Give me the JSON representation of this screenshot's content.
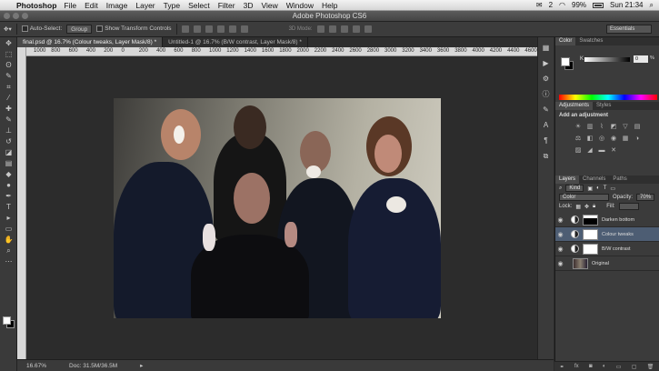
{
  "menubar": {
    "app": "Photoshop",
    "items": [
      "File",
      "Edit",
      "Image",
      "Layer",
      "Type",
      "Select",
      "Filter",
      "3D",
      "View",
      "Window",
      "Help"
    ],
    "status_badge": "2",
    "battery": "99%",
    "clock": "Sun 21:34"
  },
  "window": {
    "title": "Adobe Photoshop CS6"
  },
  "options": {
    "auto_select_label": "Auto-Select:",
    "auto_select_value": "Group",
    "transform_label": "Show Transform Controls",
    "mode_3d": "3D Mode:",
    "workspace": "Essentials"
  },
  "tabs": [
    "final.psd @ 16.7% (Colour tweaks, Layer Mask/8) *",
    "Untitled-1 @ 16.7% (B/W contrast, Layer Mask/8) *"
  ],
  "ruler": [
    "1000",
    "800",
    "600",
    "400",
    "200",
    "0",
    "200",
    "400",
    "600",
    "800",
    "1000",
    "1200",
    "1400",
    "1600",
    "1800",
    "2000",
    "2200",
    "2400",
    "2600",
    "2800",
    "3000",
    "3200",
    "3400",
    "3600",
    "3800",
    "4000",
    "4200",
    "4400",
    "4600",
    "4800"
  ],
  "status": {
    "zoom": "16.67%",
    "doc": "Doc: 31.5M/36.5M"
  },
  "color_panel": {
    "tabs": [
      "Color",
      "Swatches"
    ],
    "channel": "K",
    "value": "0",
    "unit": "%"
  },
  "adjustments": {
    "tabs": [
      "Adjustments",
      "Styles"
    ],
    "heading": "Add an adjustment"
  },
  "layers_panel": {
    "tabs": [
      "Layers",
      "Channels",
      "Paths"
    ],
    "filter": "Kind",
    "blend_mode": "Color",
    "opacity_label": "Opacity:",
    "opacity": "70%",
    "lock_label": "Lock:",
    "fill_label": "Fill:",
    "layers": [
      {
        "name": "Darken bottom",
        "selected": false
      },
      {
        "name": "Colour tweaks",
        "selected": true
      },
      {
        "name": "B/W contrast",
        "selected": false
      },
      {
        "name": "Original",
        "selected": false
      }
    ]
  },
  "colors": {
    "accent": "#4d5d73",
    "panel": "#3b3b3b",
    "canvas": "#2c2c2c"
  }
}
